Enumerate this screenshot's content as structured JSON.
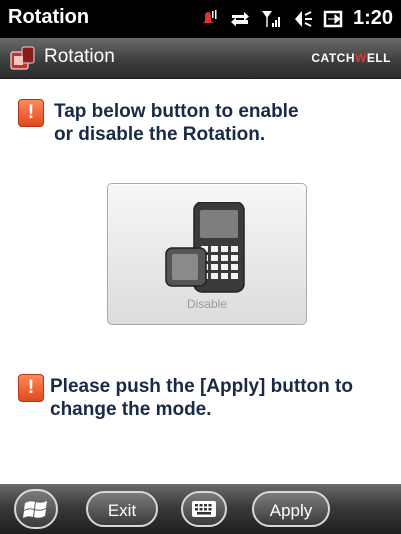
{
  "status_bar": {
    "title": "Rotation",
    "time": "1:20",
    "icons": [
      "ringer-icon",
      "data-sync-icon",
      "signal-icon",
      "volume-icon",
      "battery-charging-icon"
    ]
  },
  "app_header": {
    "title": "Rotation",
    "brand_prefix": "CATCH",
    "brand_mid": "W",
    "brand_suffix": "ELL",
    "icon": "rotation-app-icon"
  },
  "content": {
    "instruction_line1": "Tap below button to enable",
    "instruction_line2": "or disable the Rotation.",
    "toggle_button_label": "Disable",
    "note_line1": "Please push the [Apply] button to",
    "note_line2": "change the mode.",
    "warning_icon_glyph": "!"
  },
  "bottom_bar": {
    "start_icon": "windows-start-icon",
    "exit_label": "Exit",
    "keyboard_icon": "keyboard-icon",
    "apply_label": "Apply"
  },
  "colors": {
    "accent_warning": "#e4471d",
    "text_dark": "#1a2a45",
    "brand_red": "#e03a2c"
  }
}
